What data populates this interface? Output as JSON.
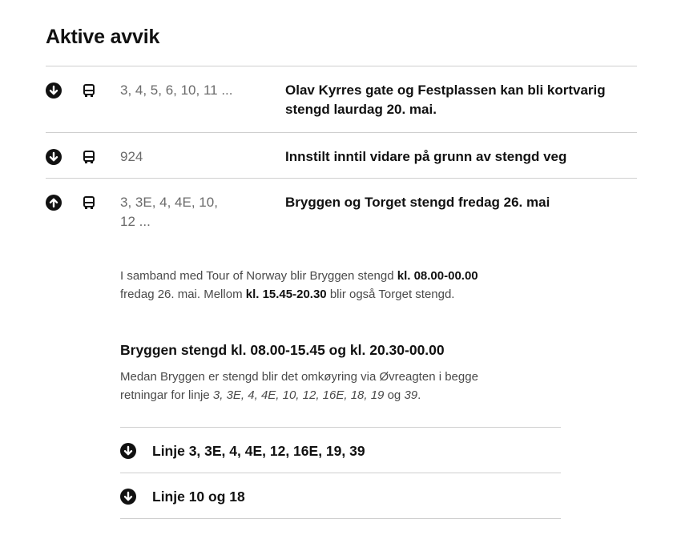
{
  "page": {
    "title": "Aktive avvik"
  },
  "deviations": [
    {
      "expanded": false,
      "lines": "3, 4, 5, 6, 10, 11 ...",
      "headline": "Olav Kyrres gate og Festplassen kan bli kortvarig stengd laurdag 20. mai."
    },
    {
      "expanded": false,
      "lines": "924",
      "headline": "Innstilt inntil vidare på grunn av stengd veg"
    },
    {
      "expanded": true,
      "lines_line1": "3, 3E, 4, 4E, 10,",
      "lines_line2": "12 ...",
      "headline": "Bryggen og Torget stengd fredag 26. mai",
      "intro": {
        "t1": "I samband med Tour of Norway blir Bryggen stengd ",
        "b1": "kl. 08.00-00.00",
        "t2": "fredag 26. mai. Mellom ",
        "b2": "kl. 15.45-20.30",
        "t3": " blir også Torget stengd."
      },
      "section_heading": "Bryggen stengd kl. 08.00-15.45 og kl. 20.30-00.00",
      "section_text": {
        "t1": "Medan Bryggen er stengd blir det omkøyring via Øvreagten i begge",
        "t2": "retningar for linje ",
        "i1": "3, 3E, 4, 4E, 10, 12, 16E, 18, 19",
        "t3": " og ",
        "i2": "39",
        "t4": "."
      },
      "sub_items": [
        {
          "label": "Linje 3, 3E, 4, 4E, 12, 16E, 19, 39",
          "expanded": false
        },
        {
          "label": "Linje 10 og 18",
          "expanded": false
        }
      ]
    }
  ],
  "icons": {
    "toggle_down": "arrow-down-circle-icon",
    "toggle_up": "arrow-up-circle-icon",
    "bus": "bus-icon"
  },
  "colors": {
    "text": "#111111",
    "muted": "#6b6b6b",
    "rule": "#cfcfcf"
  }
}
